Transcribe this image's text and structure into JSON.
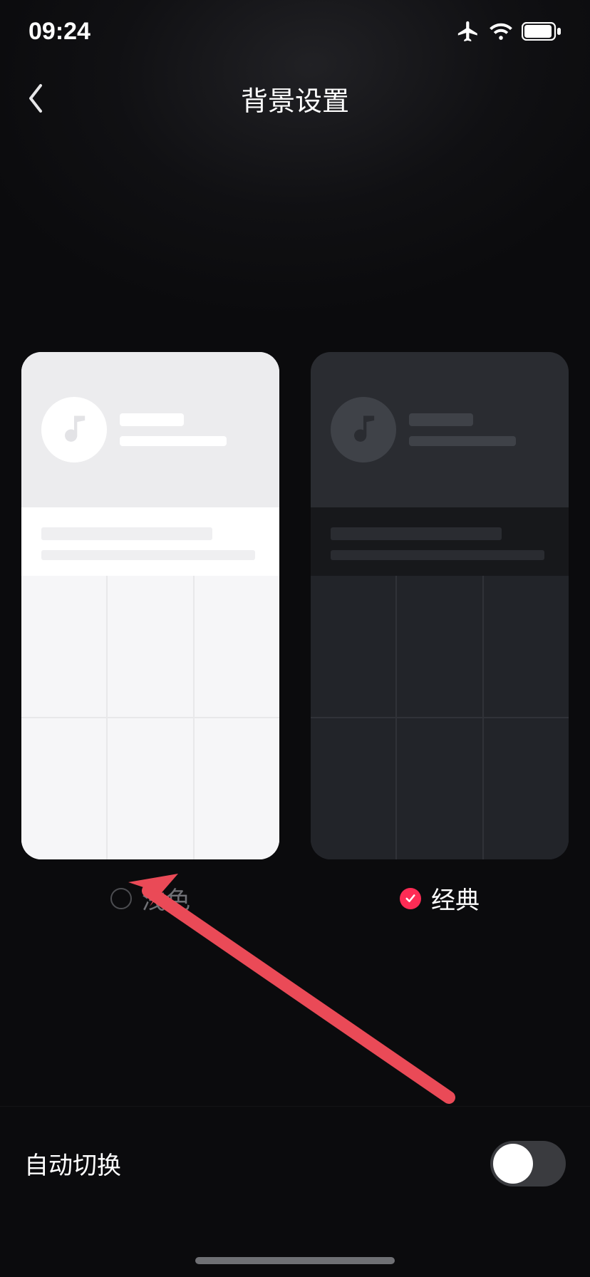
{
  "status": {
    "time": "09:24"
  },
  "header": {
    "title": "背景设置"
  },
  "themes": {
    "light": {
      "label": "浅色",
      "selected": false
    },
    "dark": {
      "label": "经典",
      "selected": true
    }
  },
  "auto_switch": {
    "label": "自动切换",
    "on": false
  }
}
